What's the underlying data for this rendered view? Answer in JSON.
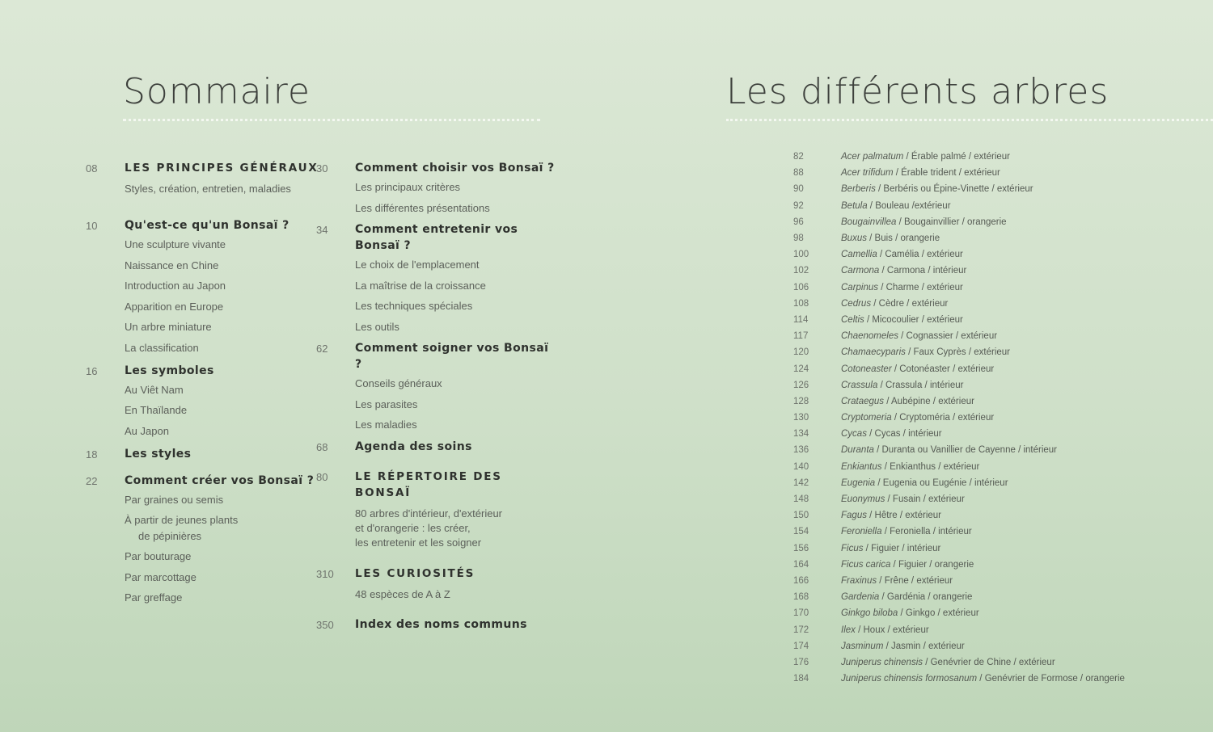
{
  "left": {
    "title": "Sommaire",
    "col1": [
      {
        "num": "08",
        "head": "Les principes généraux",
        "caps": true,
        "sub": "Styles, création, entretien, maladies",
        "gap": 0
      },
      {
        "num": "10",
        "head": "Qu'est-ce qu'un Bonsaï ?",
        "items": [
          "Une sculpture vivante",
          "Naissance en Chine",
          "Introduction au Japon",
          "Apparition en Europe",
          "Un arbre miniature",
          "La classification"
        ],
        "gap": 26
      },
      {
        "num": "16",
        "head": "Les symboles",
        "items": [
          "Au Viêt Nam",
          "En Thaïlande",
          "Au Japon"
        ],
        "gap": 9
      },
      {
        "num": "18",
        "head": "Les styles",
        "gap": 9
      },
      {
        "num": "22",
        "head": "Comment créer vos Bonsaï ?",
        "items": [
          "Par graines ou semis",
          "À partir de jeunes plants",
          "de pépinières",
          "Par bouturage",
          "Par marcottage",
          "Par greffage"
        ],
        "gap": 13
      }
    ],
    "col2": [
      {
        "num": "30",
        "head": "Comment choisir vos Bonsaï ?",
        "items": [
          "Les principaux critères",
          "Les différentes présentations"
        ],
        "gap": 0
      },
      {
        "num": "34",
        "head": "Comment entretenir vos Bonsaï ?",
        "items": [
          "Le choix de l'emplacement",
          "La maîtrise de la croissance",
          "Les techniques spéciales",
          "Les outils"
        ],
        "gap": 7
      },
      {
        "num": "62",
        "head": "Comment soigner vos Bonsaï ?",
        "items": [
          "Conseils généraux",
          "Les parasites",
          "Les maladies"
        ],
        "gap": 7
      },
      {
        "num": "68",
        "head": "Agenda des soins",
        "gap": 7
      },
      {
        "num": "80",
        "head": "Le répertoire des Bonsaï",
        "caps": true,
        "desc": "80 arbres d'intérieur, d'extérieur\net d'orangerie : les créer,\nles entretenir et les soigner",
        "gap": 17
      },
      {
        "num": "310",
        "head": "Les curiosités",
        "caps": true,
        "sub": "48 espèces de A à Z",
        "gap": 19
      },
      {
        "num": "350",
        "head": "Index des noms communs",
        "gap": 18
      }
    ]
  },
  "right": {
    "title": "Les différents arbres",
    "trees": [
      {
        "page": "82",
        "latin": "Acer palmatum",
        "rest": " / Érable palmé / extérieur"
      },
      {
        "page": "88",
        "latin": "Acer trifidum",
        "rest": " / Érable trident / extérieur"
      },
      {
        "page": "90",
        "latin": "Berberis",
        "rest": " / Berbéris ou Épine-Vinette / extérieur"
      },
      {
        "page": "92",
        "latin": "Betula",
        "rest": " / Bouleau /extérieur"
      },
      {
        "page": "96",
        "latin": "Bougainvillea",
        "rest": " / Bougainvillier / orangerie"
      },
      {
        "page": "98",
        "latin": "Buxus",
        "rest": " / Buis / orangerie"
      },
      {
        "page": "100",
        "latin": "Camellia",
        "rest": " / Camélia / extérieur"
      },
      {
        "page": "102",
        "latin": "Carmona",
        "rest": " / Carmona / intérieur"
      },
      {
        "page": "106",
        "latin": "Carpinus",
        "rest": " / Charme / extérieur"
      },
      {
        "page": "108",
        "latin": "Cedrus",
        "rest": " / Cèdre / extérieur"
      },
      {
        "page": "114",
        "latin": "Celtis",
        "rest": " / Micocoulier / extérieur"
      },
      {
        "page": "117",
        "latin": "Chaenomeles",
        "rest": " / Cognassier / extérieur"
      },
      {
        "page": "120",
        "latin": "Chamaecyparis",
        "rest": " / Faux Cyprès / extérieur"
      },
      {
        "page": "124",
        "latin": "Cotoneaster",
        "rest": " / Cotonéaster / extérieur"
      },
      {
        "page": "126",
        "latin": "Crassula",
        "rest": " / Crassula / intérieur"
      },
      {
        "page": "128",
        "latin": "Crataegus",
        "rest": " / Aubépine / extérieur"
      },
      {
        "page": "130",
        "latin": "Cryptomeria",
        "rest": " / Cryptoméria / extérieur"
      },
      {
        "page": "134",
        "latin": "Cycas",
        "rest": " / Cycas / intérieur"
      },
      {
        "page": "136",
        "latin": "Duranta",
        "rest": " / Duranta ou Vanillier de Cayenne / intérieur"
      },
      {
        "page": "140",
        "latin": "Enkiantus",
        "rest": " / Enkianthus / extérieur"
      },
      {
        "page": "142",
        "latin": "Eugenia",
        "rest": " / Eugenia ou Eugénie / intérieur"
      },
      {
        "page": "148",
        "latin": "Euonymus",
        "rest": " / Fusain / extérieur"
      },
      {
        "page": "150",
        "latin": "Fagus",
        "rest": " / Hêtre / extérieur"
      },
      {
        "page": "154",
        "latin": "Feroniella",
        "rest": " / Feroniella / intérieur"
      },
      {
        "page": "156",
        "latin": "Ficus",
        "rest": " / Figuier / intérieur"
      },
      {
        "page": "164",
        "latin": "Ficus carica",
        "rest": " / Figuier / orangerie"
      },
      {
        "page": "166",
        "latin": "Fraxinus",
        "rest": " / Frêne / extérieur"
      },
      {
        "page": "168",
        "latin": "Gardenia",
        "rest": " / Gardénia / orangerie"
      },
      {
        "page": "170",
        "latin": "Ginkgo biloba",
        "rest": " / Ginkgo / extérieur"
      },
      {
        "page": "172",
        "latin": "Ilex",
        "rest": " / Houx / extérieur"
      },
      {
        "page": "174",
        "latin": "Jasminum",
        "rest": " / Jasmin / extérieur"
      },
      {
        "page": "176",
        "latin": "Juniperus chinensis",
        "rest": " / Genévrier de Chine / extérieur"
      },
      {
        "page": "184",
        "latin": "Juniperus chinensis formosanum",
        "rest": " / Genévrier de Formose / orangerie"
      }
    ]
  }
}
